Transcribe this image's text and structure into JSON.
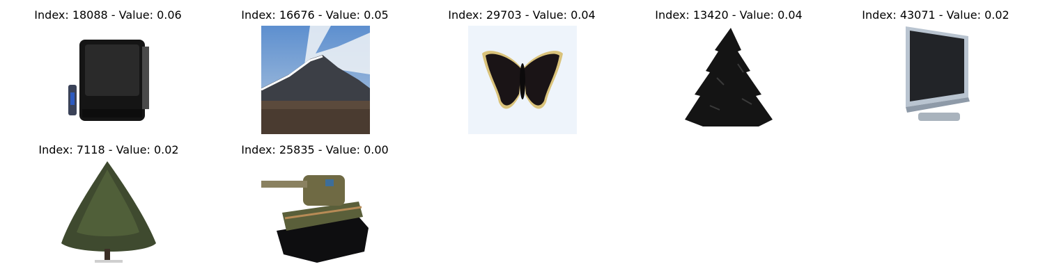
{
  "tiles": [
    {
      "index": "18088",
      "value": "0.06",
      "title": "Index: 18088 - Value: 0.06",
      "subject": "crt-television-with-remote"
    },
    {
      "index": "16676",
      "value": "0.05",
      "title": "Index: 16676 - Value: 0.05",
      "subject": "mountain-landscape"
    },
    {
      "index": "29703",
      "value": "0.04",
      "title": "Index: 29703 - Value: 0.04",
      "subject": "dark-butterfly"
    },
    {
      "index": "13420",
      "value": "0.04",
      "title": "Index: 13420 - Value: 0.04",
      "subject": "dark-fir-tree"
    },
    {
      "index": "43071",
      "value": "0.02",
      "title": "Index: 43071 - Value: 0.02",
      "subject": "flat-screen-television"
    },
    {
      "index": "7118",
      "value": "0.02",
      "title": "Index: 7118 - Value: 0.02",
      "subject": "green-conifer-tree"
    },
    {
      "index": "25835",
      "value": "0.00",
      "title": "Index: 25835 - Value: 0.00",
      "subject": "toy-tank"
    }
  ]
}
